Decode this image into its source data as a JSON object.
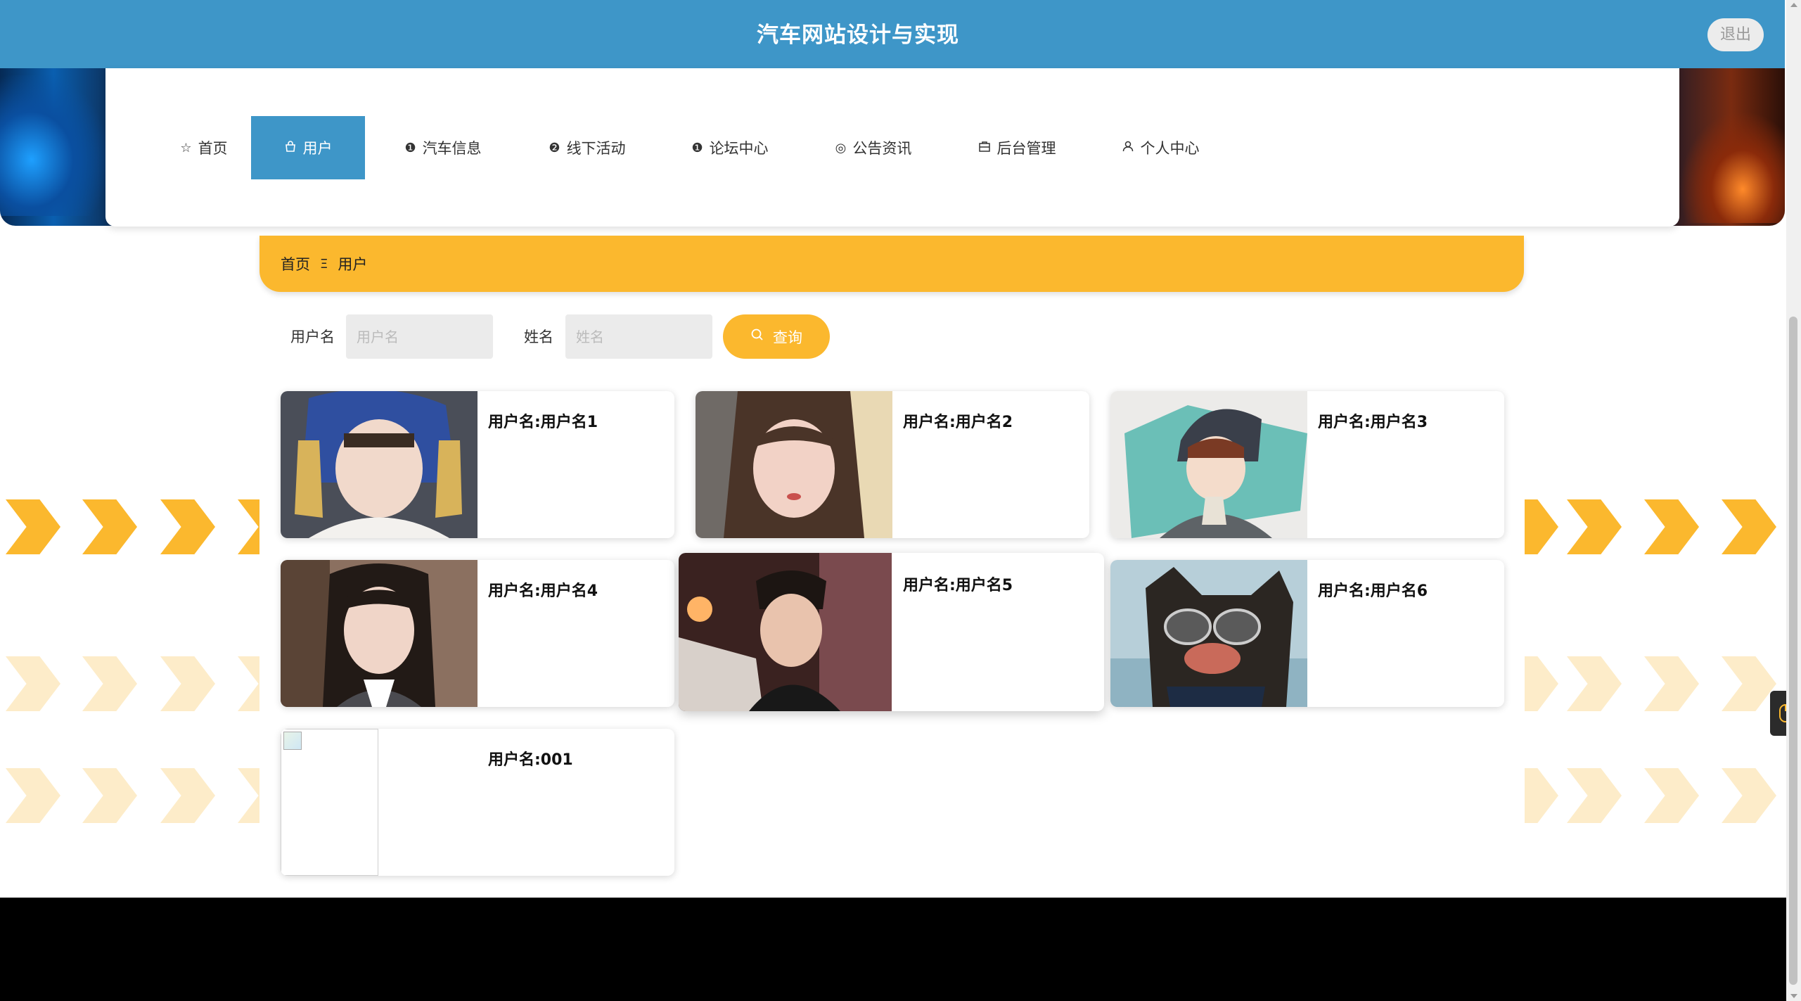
{
  "header": {
    "title": "汽车网站设计与实现",
    "logout_label": "退出"
  },
  "nav": {
    "items": [
      {
        "label": "首页",
        "icon": "star-icon"
      },
      {
        "label": "用户",
        "icon": "bag-icon",
        "active": true
      },
      {
        "label": "汽车信息",
        "icon": "info-circle-icon"
      },
      {
        "label": "线下活动",
        "icon": "question-circle-icon"
      },
      {
        "label": "论坛中心",
        "icon": "info-circle-icon"
      },
      {
        "label": "公告资讯",
        "icon": "radio-icon"
      },
      {
        "label": "后台管理",
        "icon": "briefcase-icon"
      },
      {
        "label": "个人中心",
        "icon": "user-icon"
      }
    ]
  },
  "breadcrumb": {
    "home": "首页",
    "separator": "Ξ",
    "current": "用户"
  },
  "search": {
    "username_label": "用户名",
    "username_placeholder": "用户名",
    "name_label": "姓名",
    "name_placeholder": "姓名",
    "button_label": "查询"
  },
  "users": [
    {
      "label": "用户名:用户名1"
    },
    {
      "label": "用户名:用户名2"
    },
    {
      "label": "用户名:用户名3"
    },
    {
      "label": "用户名:用户名4"
    },
    {
      "label": "用户名:用户名5"
    },
    {
      "label": "用户名:用户名6"
    },
    {
      "label": "用户名:001"
    }
  ],
  "colors": {
    "header_blue": "#3e96c8",
    "accent_yellow": "#fbb82e"
  }
}
